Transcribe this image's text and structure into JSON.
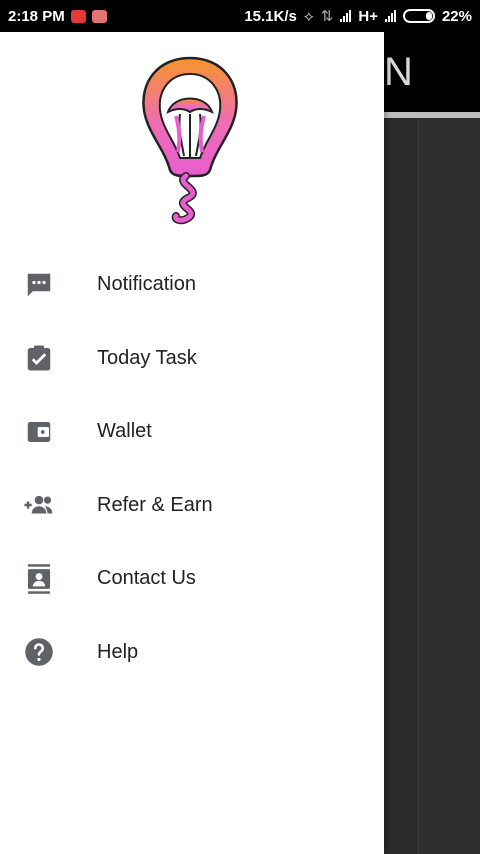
{
  "status_bar": {
    "time": "2:18 PM",
    "net_speed": "15.1K/s",
    "network_type": "H+",
    "battery": "22%",
    "notification_icons": [
      "youtube-icon",
      "gmail-icon"
    ]
  },
  "app_header": {
    "partial_title": "N"
  },
  "drawer": {
    "menu": [
      {
        "label": "Notification",
        "icon": "chat-bubble-icon"
      },
      {
        "label": "Today Task",
        "icon": "clipboard-check-icon"
      },
      {
        "label": "Wallet",
        "icon": "wallet-icon"
      },
      {
        "label": "Refer & Earn",
        "icon": "add-group-icon"
      },
      {
        "label": "Contact Us",
        "icon": "contact-card-icon"
      },
      {
        "label": "Help",
        "icon": "help-icon"
      }
    ]
  },
  "colors": {
    "icon_gray": "#5f6368",
    "logo_orange": "#f7942c",
    "logo_pink": "#e85dd0"
  }
}
